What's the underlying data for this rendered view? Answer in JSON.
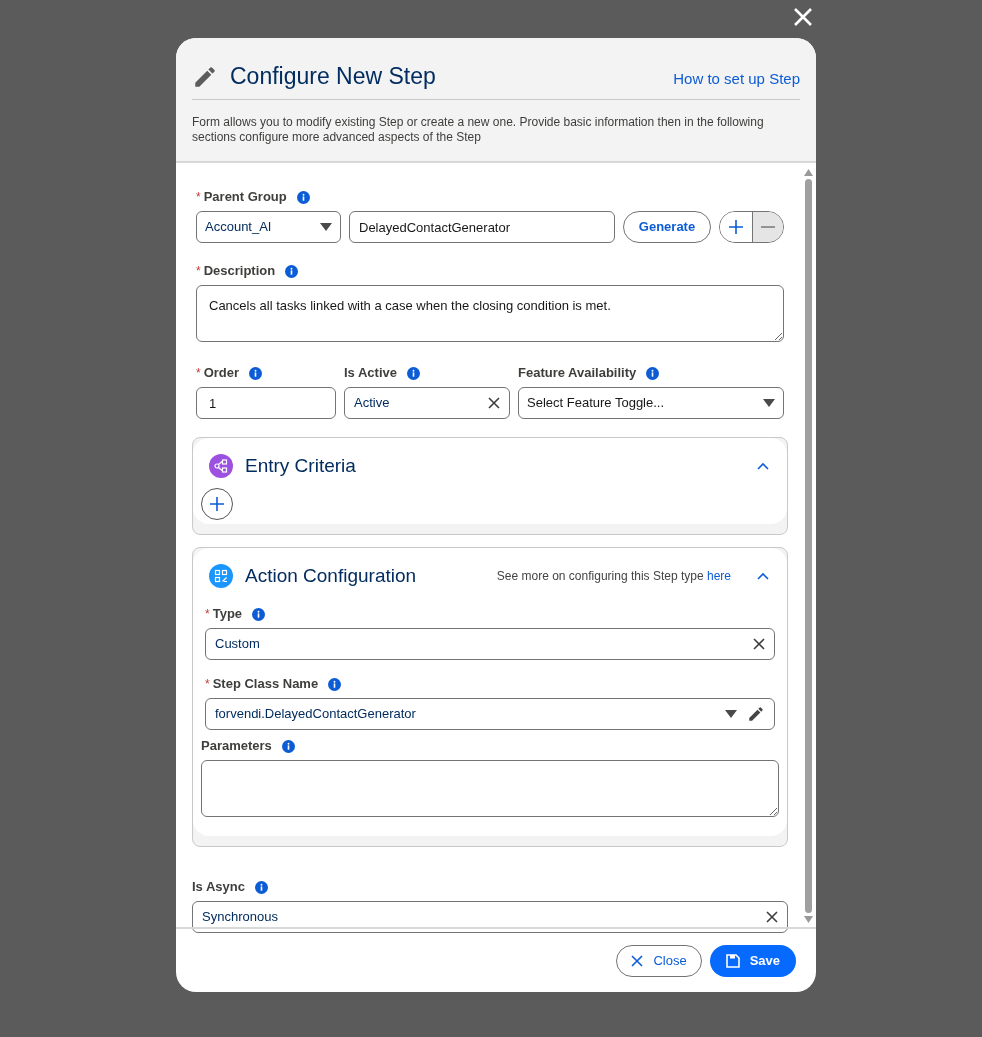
{
  "dialog": {
    "title": "Configure New Step",
    "help_link": "How to set up Step",
    "intro": "Form allows you to modify existing Step or create a new one. Provide basic information then in the following sections configure more advanced aspects of the Step"
  },
  "parent_group": {
    "label": "Parent Group",
    "required_mark": "*",
    "group": "Account_AI",
    "name": "DelayedContactGenerator",
    "generate_button": "Generate"
  },
  "description_field": {
    "label": "Description",
    "required_mark": "*",
    "kind": "textarea",
    "value": "Cancels all tasks linked with a case when the closing condition is met."
  },
  "row_fields": [
    {
      "label": "Order",
      "required_mark": "*",
      "kind": "text",
      "value": "1"
    },
    {
      "label": "Is Active",
      "kind": "clearable",
      "value": "Active"
    },
    {
      "label": "Feature Availability",
      "kind": "select",
      "placeholder": "Select Feature Toggle..."
    }
  ],
  "sections": [
    {
      "kind": "entry",
      "title": "Entry Criteria",
      "expanded": true
    },
    {
      "kind": "action",
      "title": "Action Configuration",
      "expanded": true,
      "hint": "See more on configuring this Step type",
      "hint_link": "here",
      "fields": [
        {
          "label": "Type",
          "required_mark": "*",
          "kind": "clearable",
          "value": "Custom"
        },
        {
          "label": "Step Class Name",
          "required_mark": "*",
          "kind": "lookup",
          "value": "forvendi.DelayedContactGenerator"
        },
        {
          "label": "Parameters",
          "kind": "textarea"
        }
      ]
    }
  ],
  "is_async": {
    "label": "Is Async",
    "kind": "clearable",
    "value": "Synchronous"
  },
  "buttons": [
    {
      "kind": "close",
      "label": "Close"
    },
    {
      "kind": "save",
      "label": "Save"
    }
  ]
}
